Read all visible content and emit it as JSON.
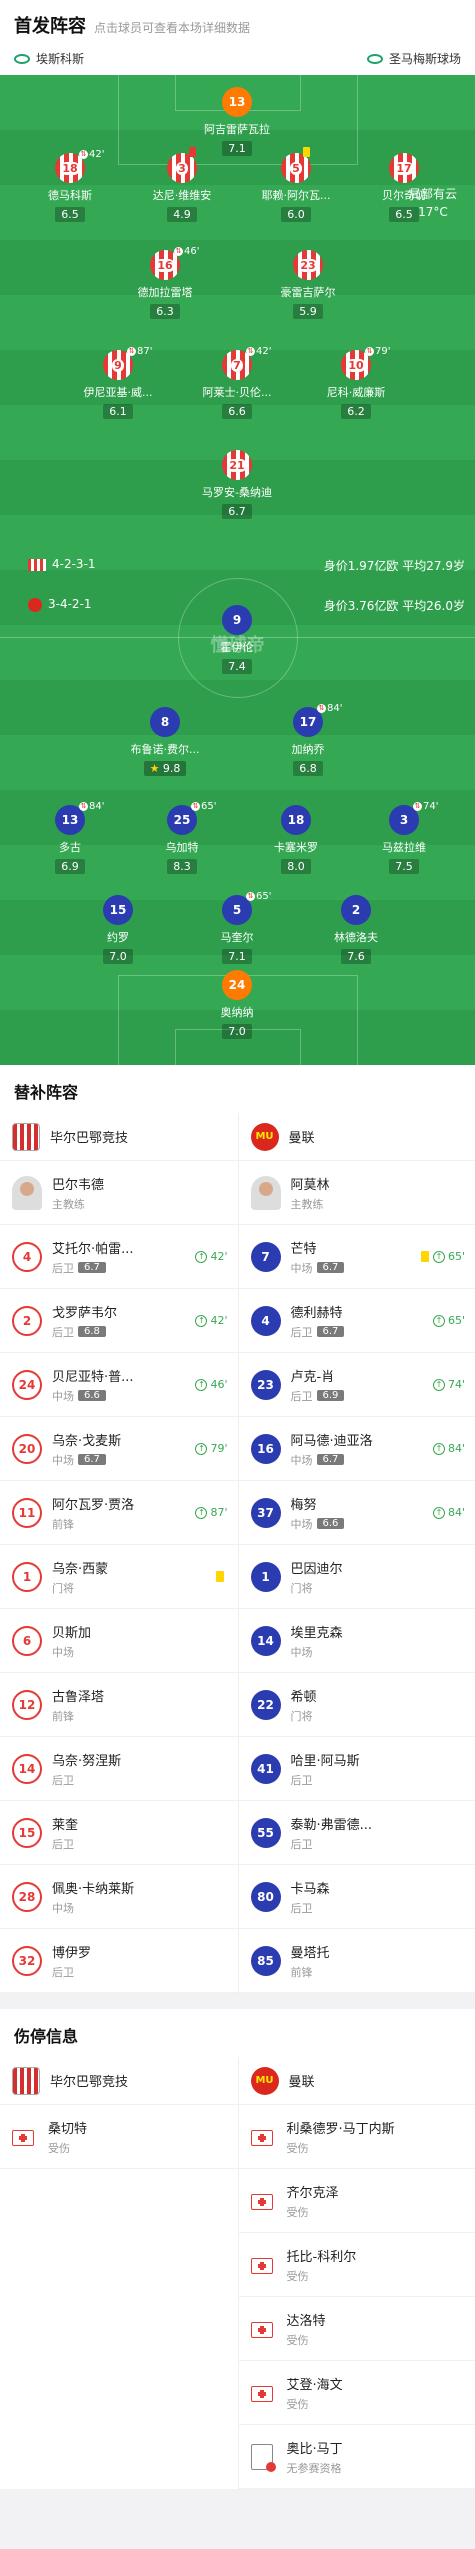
{
  "header": {
    "title": "首发阵容",
    "subtitle": "点击球员可查看本场详细数据"
  },
  "teams_bar": {
    "home_stadium": "埃斯科斯",
    "away_stadium": "圣马梅斯球场"
  },
  "weather": {
    "desc": "局部有云",
    "temp": "17°C"
  },
  "watermark": "懂球帝",
  "home_team": {
    "formation": "4-2-3-1",
    "value": "身价1.97亿欧",
    "age": "平均27.9岁"
  },
  "away_team": {
    "formation": "3-4-2-1",
    "value": "身价3.76亿欧",
    "age": "平均26.0岁"
  },
  "home_players": [
    {
      "num": "13",
      "name": "阿吉雷萨瓦拉",
      "rating": "7.1",
      "gk": true
    },
    {
      "num": "18",
      "name": "德马科斯",
      "rating": "6.5",
      "sub": "42'"
    },
    {
      "num": "3",
      "name": "达尼·维维安",
      "rating": "4.9",
      "card": "red"
    },
    {
      "num": "5",
      "name": "耶赖·阿尔瓦...",
      "rating": "6.0",
      "card": "yellow"
    },
    {
      "num": "17",
      "name": "贝尔奇切",
      "rating": "6.5"
    },
    {
      "num": "16",
      "name": "德加拉雷塔",
      "rating": "6.3",
      "sub": "46'"
    },
    {
      "num": "23",
      "name": "豪雷吉萨尔",
      "rating": "5.9"
    },
    {
      "num": "9",
      "name": "伊尼亚基·威...",
      "rating": "6.1",
      "sub": "87'"
    },
    {
      "num": "7",
      "name": "阿莱士·贝伦...",
      "rating": "6.6",
      "sub": "42'"
    },
    {
      "num": "10",
      "name": "尼科·威廉斯",
      "rating": "6.2",
      "sub": "79'"
    },
    {
      "num": "21",
      "name": "马罗安-桑纳迪",
      "rating": "6.7"
    }
  ],
  "away_players": [
    {
      "num": "9",
      "name": "霍伊伦",
      "rating": "7.4"
    },
    {
      "num": "8",
      "name": "布鲁诺·费尔...",
      "rating": "9.8",
      "best": true
    },
    {
      "num": "17",
      "name": "加纳乔",
      "rating": "6.8",
      "sub": "84'"
    },
    {
      "num": "13",
      "name": "多古",
      "rating": "6.9",
      "sub": "84'"
    },
    {
      "num": "25",
      "name": "乌加特",
      "rating": "8.3",
      "sub": "65'"
    },
    {
      "num": "18",
      "name": "卡塞米罗",
      "rating": "8.0"
    },
    {
      "num": "3",
      "name": "马兹拉维",
      "rating": "7.5",
      "sub": "74'"
    },
    {
      "num": "15",
      "name": "约罗",
      "rating": "7.0"
    },
    {
      "num": "5",
      "name": "马奎尔",
      "rating": "7.1",
      "sub": "65'"
    },
    {
      "num": "2",
      "name": "林德洛夫",
      "rating": "7.6"
    },
    {
      "num": "24",
      "name": "奥纳纳",
      "rating": "7.0",
      "gk": true
    }
  ],
  "subs": {
    "title": "替补阵容",
    "home_team": "毕尔巴鄂竞技",
    "away_team": "曼联",
    "home_coach": {
      "name": "巴尔韦德",
      "role": "主教练"
    },
    "away_coach": {
      "name": "阿莫林",
      "role": "主教练"
    },
    "home": [
      {
        "num": "4",
        "name": "艾托尔·帕雷...",
        "pos": "后卫",
        "rating": "6.7",
        "evt": "42'"
      },
      {
        "num": "2",
        "name": "戈罗萨韦尔",
        "pos": "后卫",
        "rating": "6.8",
        "evt": "42'"
      },
      {
        "num": "24",
        "name": "贝尼亚特·普...",
        "pos": "中场",
        "rating": "6.6",
        "evt": "46'"
      },
      {
        "num": "20",
        "name": "乌奈·戈麦斯",
        "pos": "中场",
        "rating": "6.7",
        "evt": "79'"
      },
      {
        "num": "11",
        "name": "阿尔瓦罗·贾洛",
        "pos": "前锋",
        "rating": "",
        "evt": "87'"
      },
      {
        "num": "1",
        "name": "乌奈·西蒙",
        "pos": "门将",
        "rating": "",
        "evt": "",
        "yc": true
      },
      {
        "num": "6",
        "name": "贝斯加",
        "pos": "中场",
        "rating": "",
        "evt": ""
      },
      {
        "num": "12",
        "name": "古鲁泽塔",
        "pos": "前锋",
        "rating": "",
        "evt": ""
      },
      {
        "num": "14",
        "name": "乌奈·努涅斯",
        "pos": "后卫",
        "rating": "",
        "evt": ""
      },
      {
        "num": "15",
        "name": "莱奎",
        "pos": "后卫",
        "rating": "",
        "evt": ""
      },
      {
        "num": "28",
        "name": "佩奥·卡纳莱斯",
        "pos": "中场",
        "rating": "",
        "evt": ""
      },
      {
        "num": "32",
        "name": "博伊罗",
        "pos": "后卫",
        "rating": "",
        "evt": ""
      }
    ],
    "away": [
      {
        "num": "7",
        "name": "芒特",
        "pos": "中场",
        "rating": "6.7",
        "evt": "65'",
        "yc": true
      },
      {
        "num": "4",
        "name": "德利赫特",
        "pos": "后卫",
        "rating": "6.7",
        "evt": "65'"
      },
      {
        "num": "23",
        "name": "卢克-肖",
        "pos": "后卫",
        "rating": "6.9",
        "evt": "74'"
      },
      {
        "num": "16",
        "name": "阿马德·迪亚洛",
        "pos": "中场",
        "rating": "6.7",
        "evt": "84'"
      },
      {
        "num": "37",
        "name": "梅努",
        "pos": "中场",
        "rating": "6.6",
        "evt": "84'"
      },
      {
        "num": "1",
        "name": "巴因迪尔",
        "pos": "门将",
        "rating": "",
        "evt": ""
      },
      {
        "num": "14",
        "name": "埃里克森",
        "pos": "中场",
        "rating": "",
        "evt": ""
      },
      {
        "num": "22",
        "name": "希顿",
        "pos": "门将",
        "rating": "",
        "evt": ""
      },
      {
        "num": "41",
        "name": "哈里·阿马斯",
        "pos": "后卫",
        "rating": "",
        "evt": ""
      },
      {
        "num": "55",
        "name": "泰勒·弗雷德...",
        "pos": "后卫",
        "rating": "",
        "evt": ""
      },
      {
        "num": "80",
        "name": "卡马森",
        "pos": "后卫",
        "rating": "",
        "evt": ""
      },
      {
        "num": "85",
        "name": "曼塔托",
        "pos": "前锋",
        "rating": "",
        "evt": ""
      }
    ]
  },
  "injuries": {
    "title": "伤停信息",
    "home_team": "毕尔巴鄂竞技",
    "away_team": "曼联",
    "home": [
      {
        "name": "桑切特",
        "status": "受伤"
      }
    ],
    "away": [
      {
        "name": "利桑德罗·马丁内斯",
        "status": "受伤"
      },
      {
        "name": "齐尔克泽",
        "status": "受伤"
      },
      {
        "name": "托比-科利尔",
        "status": "受伤"
      },
      {
        "name": "达洛特",
        "status": "受伤"
      },
      {
        "name": "艾登·海文",
        "status": "受伤"
      },
      {
        "name": "奥比·马丁",
        "status": "无参赛资格",
        "suspended": true
      }
    ]
  }
}
